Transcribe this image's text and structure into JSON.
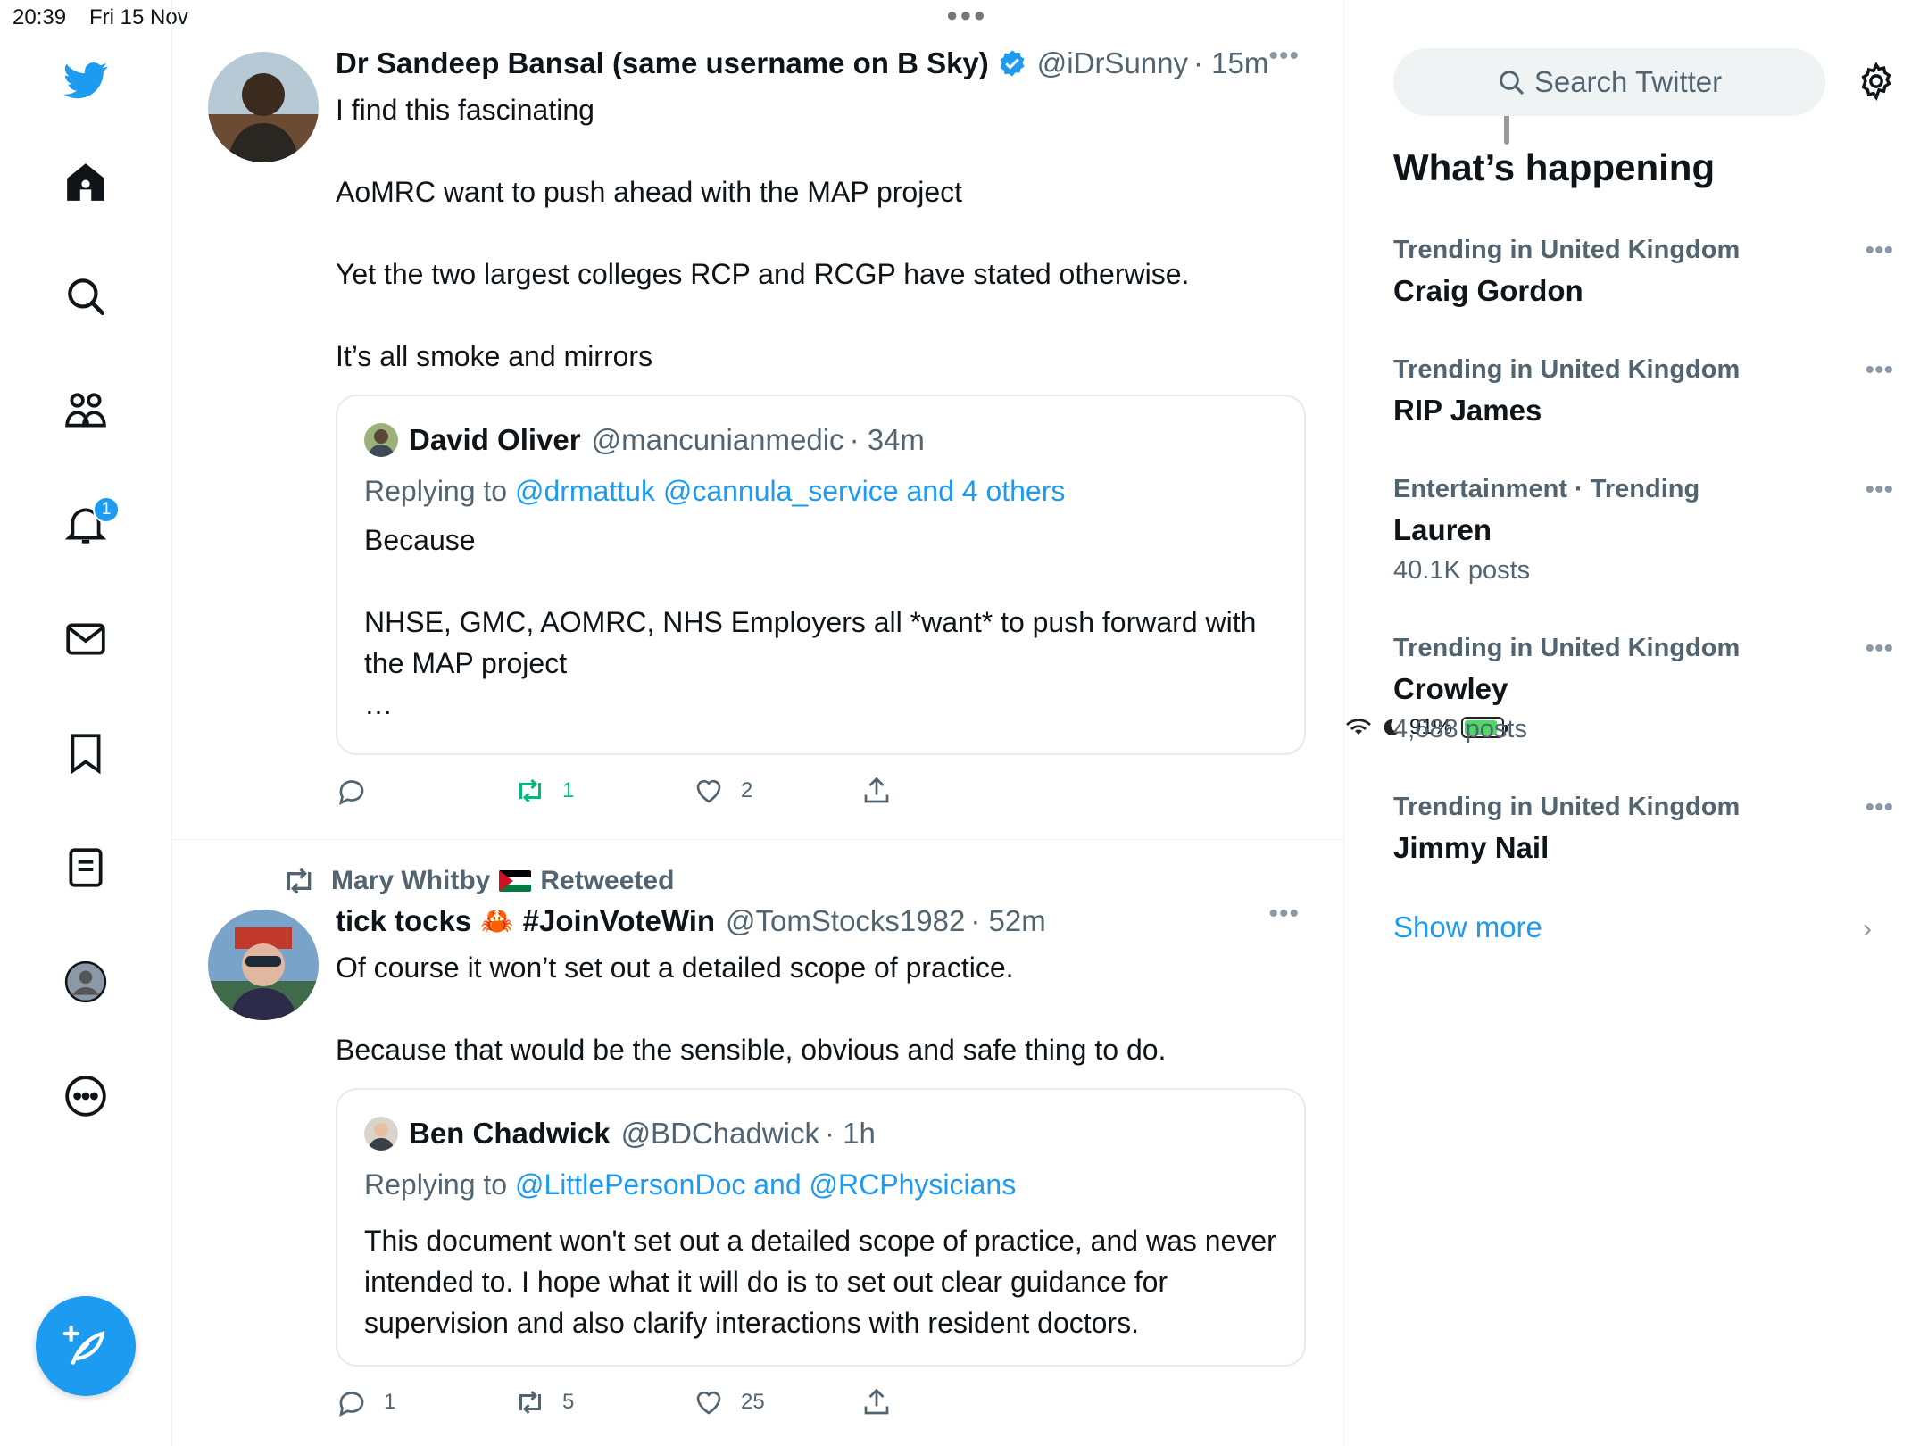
{
  "status_bar": {
    "time": "20:39",
    "date": "Fri 15 Nov",
    "battery": "91%",
    "battery_level": 0.91
  },
  "nav": {
    "notifications_badge": "1"
  },
  "timeline": {
    "tweets": [
      {
        "author_name": "Dr Sandeep Bansal (same username on B Sky)",
        "handle": "@iDrSunny",
        "time": "· 15m",
        "text": "I find this fascinating\n\nAoMRC want to push ahead with the MAP project\n\nYet the two largest colleges RCP and RCGP have stated otherwise.\n\nIt’s all smoke and mirrors",
        "quote": {
          "author_name": "David Oliver",
          "handle": "@mancunianmedic",
          "time": "· 34m",
          "replying_prefix": "Replying to ",
          "replying_to": "@drmattuk @cannula_service and 4 others",
          "text": "Because\n\nNHSE, GMC, AOMRC, NHS Employers all *want* to push forward with the MAP project\n…"
        },
        "replies": "",
        "retweets": "1",
        "likes": "2"
      },
      {
        "retweeted_by": "Mary Whitby",
        "retweeted_label": "Retweeted",
        "author_name_a": "tick tocks",
        "author_name_b": "#JoinVoteWin",
        "handle": "@TomStocks1982",
        "time": "· 52m",
        "text": "Of course it won’t set out a detailed scope of practice.\n\nBecause that would be the sensible, obvious and safe thing to do.",
        "quote": {
          "author_name": "Ben Chadwick",
          "handle": "@BDChadwick",
          "time": "· 1h",
          "replying_prefix": "Replying to ",
          "replying_to": "@LittlePersonDoc and @RCPhysicians",
          "text": "This document won't set out a detailed scope of practice, and was never intended to. I hope what it will do is to set out clear guidance for supervision and also clarify interactions with resident doctors."
        },
        "replies": "1",
        "retweets": "5",
        "likes": "25"
      }
    ]
  },
  "sidebar": {
    "search_placeholder": "Search Twitter",
    "title": "What’s happening",
    "trends": [
      {
        "context": "Trending in United Kingdom",
        "name": "Craig Gordon",
        "posts": ""
      },
      {
        "context": "Trending in United Kingdom",
        "name": "RIP James",
        "posts": ""
      },
      {
        "context": "Entertainment · Trending",
        "name": "Lauren",
        "posts": "40.1K posts"
      },
      {
        "context": "Trending in United Kingdom",
        "name": "Crowley",
        "posts": "4,688 posts"
      },
      {
        "context": "Trending in United Kingdom",
        "name": "Jimmy Nail",
        "posts": ""
      }
    ],
    "show_more": "Show more"
  },
  "colors": {
    "accent": "#1d9bf0",
    "retweet_green": "#00ba7c",
    "secondary_text": "#536471"
  },
  "icons": [
    "twitter-bird-icon",
    "home-icon",
    "search-icon",
    "communities-icon",
    "bell-icon",
    "mail-icon",
    "bookmark-icon",
    "lists-icon",
    "profile-icon",
    "more-circle-icon",
    "compose-icon",
    "gear-icon",
    "reply-icon",
    "retweet-icon",
    "heart-icon",
    "share-icon",
    "verified-icon",
    "crab-emoji-icon",
    "palestine-flag-icon"
  ]
}
